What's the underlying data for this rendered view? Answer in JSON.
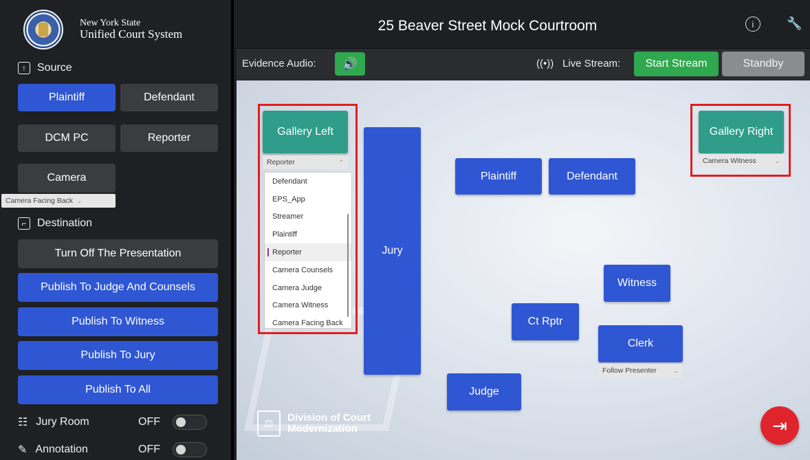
{
  "org": {
    "line1": "New York State",
    "line2": "Unified Court System"
  },
  "title": "25 Beaver Street Mock Courtroom",
  "sidebar": {
    "source_heading": "Source",
    "source_buttons": [
      "Plaintiff",
      "Defendant",
      "DCM PC",
      "Reporter",
      "Camera"
    ],
    "camera_select": "Camera Facing Back",
    "destination_heading": "Destination",
    "destination_buttons": [
      "Turn Off The Presentation",
      "Publish To Judge And Counsels",
      "Publish To Witness",
      "Publish To Jury",
      "Publish To All"
    ],
    "jury_room": {
      "label": "Jury Room",
      "state": "OFF"
    },
    "annotation": {
      "label": "Annotation",
      "state": "OFF"
    }
  },
  "subbar": {
    "evidence_audio_label": "Evidence Audio:",
    "live_stream_label": "Live Stream:",
    "start_stream": "Start Stream",
    "standby": "Standby"
  },
  "stage": {
    "gallery_left": "Gallery Left",
    "gallery_left_select": "Reporter",
    "gallery_right": "Gallery Right",
    "gallery_right_select": "Camera Witness",
    "plaintiff": "Plaintiff",
    "defendant": "Defendant",
    "jury": "Jury",
    "witness": "Witness",
    "ct_rptr": "Ct Rptr",
    "clerk": "Clerk",
    "clerk_select": "Follow Presenter",
    "judge": "Judge",
    "dropdown_options": [
      "Defendant",
      "EPS_App",
      "Streamer",
      "Plaintiff",
      "Reporter",
      "Camera Counsels",
      "Camera Judge",
      "Camera Witness",
      "Camera Facing Back"
    ],
    "dropdown_selected": "Reporter",
    "dcm_logo": {
      "line1": "Division of Court",
      "line2": "Modernization"
    }
  },
  "colors": {
    "accent_blue": "#2f56d3",
    "teal": "#2f9d8a",
    "green": "#2fa84f",
    "highlight_red": "#e01e1e"
  }
}
